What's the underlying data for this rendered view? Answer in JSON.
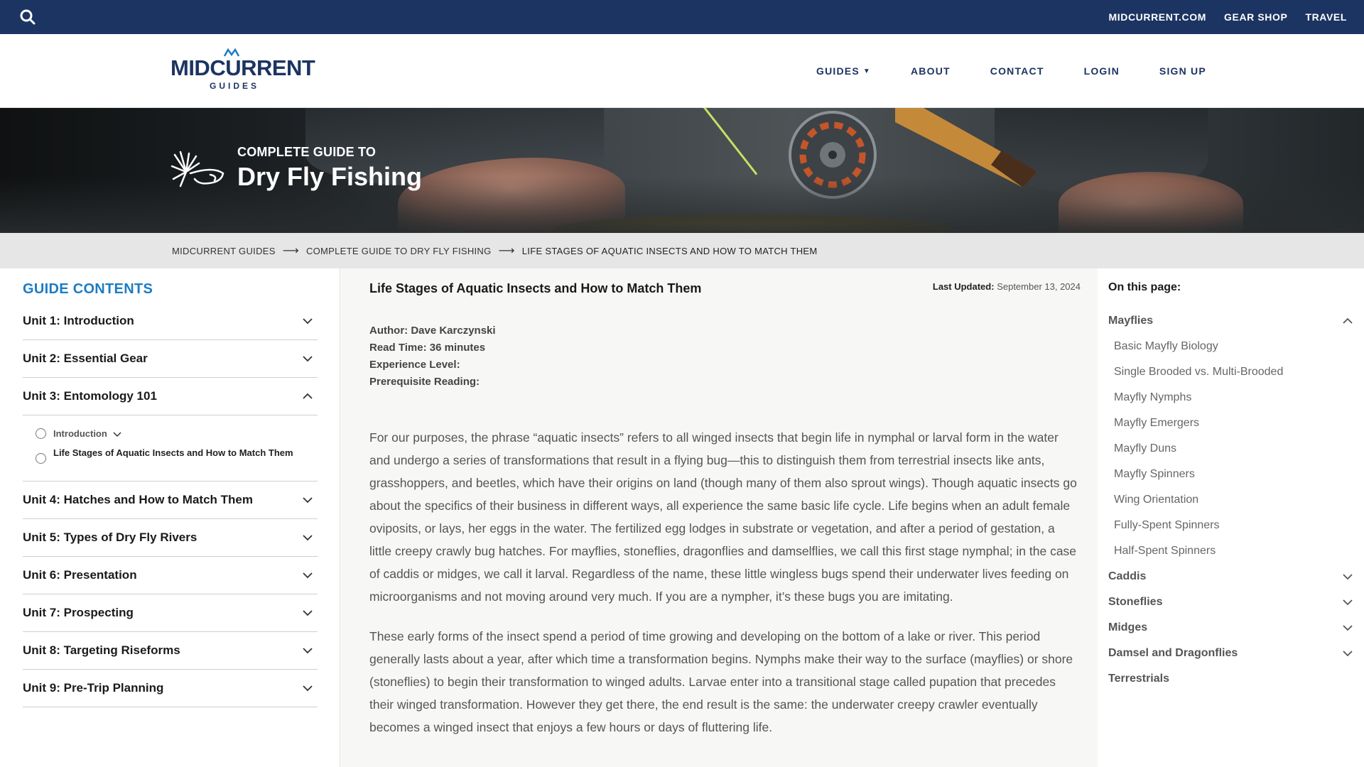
{
  "topbar": {
    "links": [
      "MIDCURRENT.COM",
      "GEAR SHOP",
      "TRAVEL"
    ]
  },
  "header": {
    "logo_text": "MIDCURRENT",
    "logo_sub": "GUIDES",
    "nav": [
      "GUIDES",
      "ABOUT",
      "CONTACT",
      "LOGIN",
      "SIGN UP"
    ]
  },
  "hero": {
    "kicker": "COMPLETE GUIDE TO",
    "title": "Dry Fly Fishing"
  },
  "breadcrumb": [
    "MIDCURRENT GUIDES",
    "COMPLETE GUIDE TO DRY FLY FISHING",
    "LIFE STAGES OF AQUATIC INSECTS AND HOW TO MATCH THEM"
  ],
  "sidebar": {
    "heading": "GUIDE CONTENTS",
    "units": [
      "Unit 1: Introduction",
      "Unit 2: Essential Gear",
      "Unit 3: Entomology 101",
      "Unit 4: Hatches and How to Match Them",
      "Unit 5: Types of Dry Fly Rivers",
      "Unit 6: Presentation",
      "Unit 7: Prospecting",
      "Unit 8: Targeting Riseforms",
      "Unit 9: Pre-Trip Planning"
    ],
    "expanded_subitems": [
      "Introduction",
      "Life Stages of Aquatic Insects and How to Match Them"
    ]
  },
  "article": {
    "title": "Life Stages of Aquatic Insects and How to Match Them",
    "updated_label": "Last Updated:",
    "updated_date": "September 13, 2024",
    "author": "Author: Dave Karczynski",
    "read_time": "Read Time: 36 minutes",
    "experience": "Experience Level:",
    "prereq": "Prerequisite Reading:",
    "paragraphs": [
      "For our purposes, the phrase “aquatic insects” refers to all winged insects that begin life in nymphal or larval form in the water and undergo a series of transformations that result in a flying bug—this to distinguish them from terrestrial insects like ants, grasshoppers, and beetles, which have their origins on land (though many of them also sprout wings). Though aquatic insects go about the specifics of their business in different ways, all experience the same basic life cycle. Life begins when an adult female oviposits, or lays, her eggs in the water. The fertilized egg lodges in substrate or vegetation, and after a period of gestation, a little creepy crawly bug hatches. For mayflies, stoneflies, dragonflies and damselflies, we call this first stage nymphal; in the case of caddis or midges, we call it larval. Regardless of the name, these little wingless bugs spend their underwater lives feeding on microorganisms and not moving around very much. If you are a nympher, it’s these bugs you are imitating.",
      "These early forms of the insect spend a period of time growing and developing on the bottom of a lake or river. This period generally lasts about a year, after which time a transformation begins. Nymphs make their way to the surface (mayflies) or shore (stoneflies) to begin their transformation to winged adults. Larvae enter into a transitional stage called pupation that precedes their winged transformation. However they get there, the end result is the same: the underwater creepy crawler eventually becomes a winged insect that enjoys a few hours or days of fluttering life."
    ]
  },
  "toc": {
    "heading": "On this page:",
    "mayflies": "Mayflies",
    "mayfly_subs": [
      "Basic Mayfly Biology",
      "Single Brooded vs. Multi-Brooded",
      "Mayfly Nymphs",
      "Mayfly Emergers",
      "Mayfly Duns",
      "Mayfly Spinners",
      "Wing Orientation",
      "Fully-Spent Spinners",
      "Half-Spent Spinners"
    ],
    "others": [
      "Caddis",
      "Stoneflies",
      "Midges",
      "Damsel and Dragonflies",
      "Terrestrials"
    ]
  },
  "colors": {
    "topbar": "#1c3461",
    "accent_blue": "#1c7cc4",
    "crumb_bg": "#e6e6e6"
  }
}
